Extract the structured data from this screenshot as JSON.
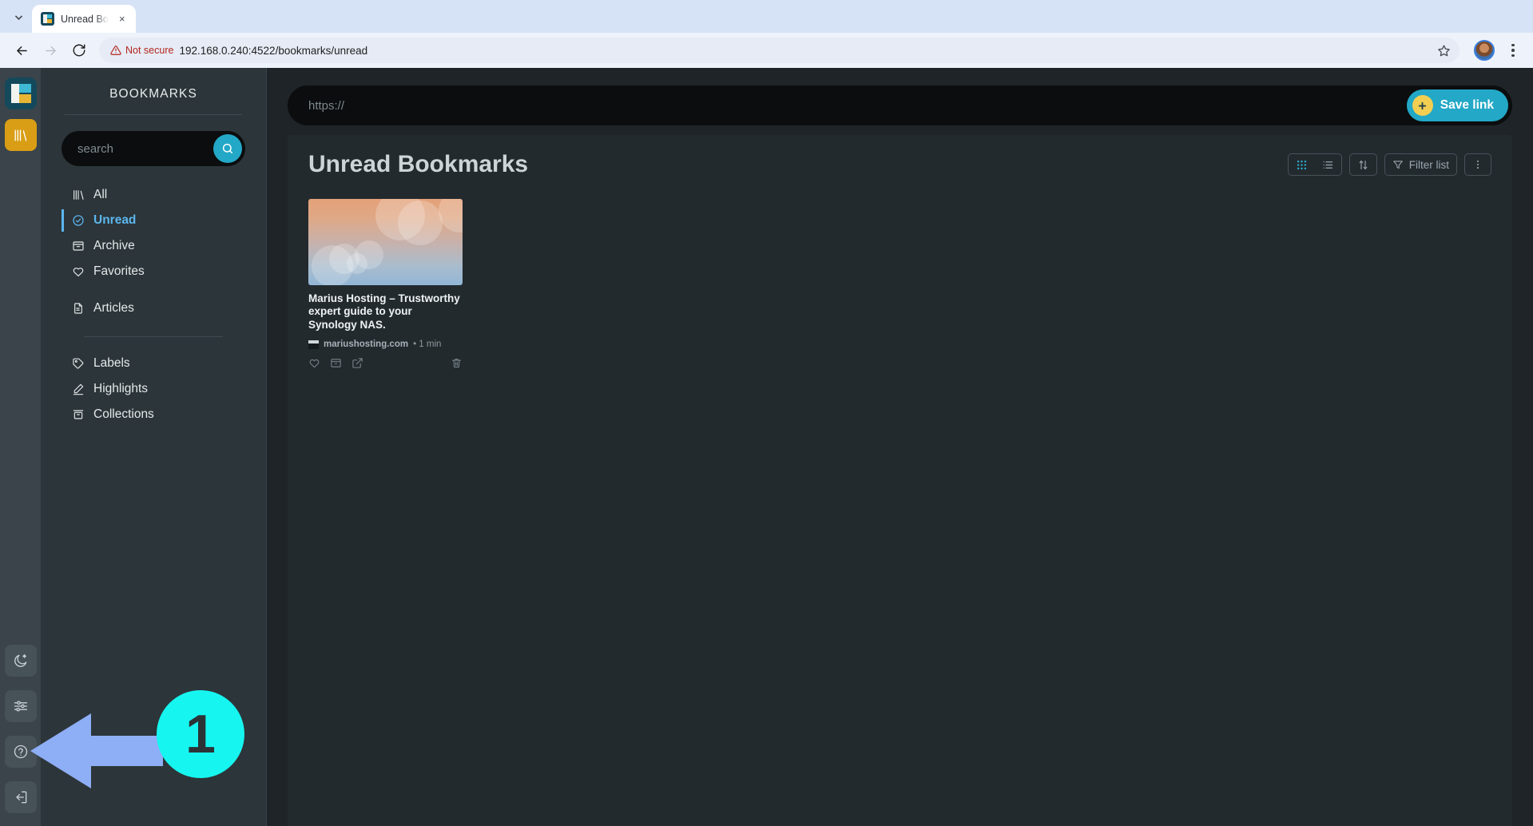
{
  "browser": {
    "tab": {
      "title": "Unread Bo",
      "favicon": "readeck-logo-icon",
      "close": "×"
    },
    "tab_list_icon": "chevron-down-icon",
    "back_icon": "arrow-left-icon",
    "forward_icon": "arrow-right-icon",
    "reload_icon": "reload-icon",
    "security_label": "Not secure",
    "security_icon": "warning-triangle-icon",
    "url": "192.168.0.240:4522/bookmarks/unread",
    "star_icon": "star-icon",
    "avatar_icon": "profile-avatar",
    "menu_icon": "chrome-menu-icon"
  },
  "rail": {
    "logo": "readeck-logo-icon",
    "items": [
      {
        "name": "bookmarks",
        "icon": "books-icon",
        "active": true
      }
    ],
    "bottom": [
      {
        "name": "dark-mode",
        "icon": "moon-stars-icon"
      },
      {
        "name": "settings",
        "icon": "sliders-icon"
      },
      {
        "name": "help",
        "icon": "question-circle-icon"
      },
      {
        "name": "logout",
        "icon": "logout-icon"
      }
    ]
  },
  "sidebar": {
    "title": "BOOKMARKS",
    "search": {
      "placeholder": "search",
      "value": "",
      "button_icon": "search-icon"
    },
    "nav": [
      {
        "label": "All",
        "icon": "books-icon",
        "active": false
      },
      {
        "label": "Unread",
        "icon": "check-circle-icon",
        "active": true
      },
      {
        "label": "Archive",
        "icon": "archive-icon",
        "active": false
      },
      {
        "label": "Favorites",
        "icon": "heart-icon",
        "active": false
      },
      {
        "label": "Articles",
        "icon": "document-icon",
        "active": false
      }
    ],
    "nav2": [
      {
        "label": "Labels",
        "icon": "tag-icon"
      },
      {
        "label": "Highlights",
        "icon": "pen-icon"
      },
      {
        "label": "Collections",
        "icon": "collection-icon"
      }
    ]
  },
  "savebar": {
    "placeholder": "https://",
    "value": "",
    "button_label": "Save link",
    "button_icon": "plus-circle-icon"
  },
  "main": {
    "title": "Unread Bookmarks",
    "tools": {
      "grid_icon": "grid-view-icon",
      "list_icon": "list-view-icon",
      "sort_icon": "sort-icon",
      "filter_icon": "filter-icon",
      "filter_label": "Filter list",
      "more_icon": "kebab-menu-icon"
    },
    "cards": [
      {
        "title": "Marius Hosting – Trustworthy expert guide to your Synology NAS.",
        "domain": "mariushosting.com",
        "time": "• 1 min",
        "actions": {
          "favorite": "heart-icon",
          "archive": "archive-icon",
          "open": "external-link-icon",
          "delete": "trash-icon"
        }
      }
    ]
  },
  "annotation": {
    "number": "1",
    "arrow": "left-arrow",
    "color": "#17f5f0"
  }
}
